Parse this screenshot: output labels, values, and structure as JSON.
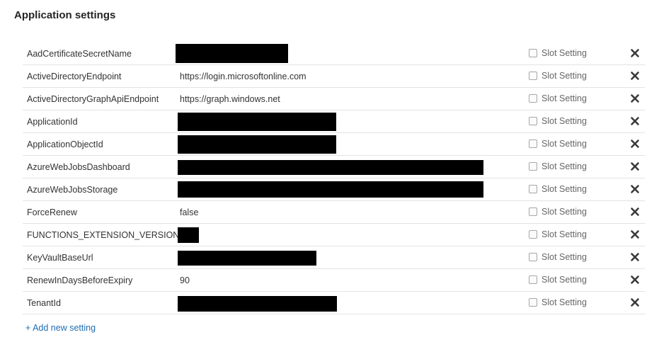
{
  "section": {
    "title": "Application settings"
  },
  "settings": [
    {
      "name": "AadCertificateSecretName",
      "value": "",
      "redacted": true,
      "slot_label": "Slot Setting",
      "slot_checked": false
    },
    {
      "name": "ActiveDirectoryEndpoint",
      "value": "https://login.microsoftonline.com",
      "redacted": false,
      "slot_label": "Slot Setting",
      "slot_checked": false
    },
    {
      "name": "ActiveDirectoryGraphApiEndpoint",
      "value": "https://graph.windows.net",
      "redacted": false,
      "slot_label": "Slot Setting",
      "slot_checked": false
    },
    {
      "name": "ApplicationId",
      "value": "",
      "redacted": true,
      "slot_label": "Slot Setting",
      "slot_checked": false
    },
    {
      "name": "ApplicationObjectId",
      "value": "",
      "redacted": true,
      "slot_label": "Slot Setting",
      "slot_checked": false
    },
    {
      "name": "AzureWebJobsDashboard",
      "value": "",
      "redacted": true,
      "slot_label": "Slot Setting",
      "slot_checked": false
    },
    {
      "name": "AzureWebJobsStorage",
      "value": "",
      "redacted": true,
      "slot_label": "Slot Setting",
      "slot_checked": false
    },
    {
      "name": "ForceRenew",
      "value": "false",
      "redacted": false,
      "slot_label": "Slot Setting",
      "slot_checked": false
    },
    {
      "name": "FUNCTIONS_EXTENSION_VERSION",
      "value": "",
      "redacted": true,
      "slot_label": "Slot Setting",
      "slot_checked": false
    },
    {
      "name": "KeyVaultBaseUrl",
      "value": "",
      "redacted": true,
      "slot_label": "Slot Setting",
      "slot_checked": false
    },
    {
      "name": "RenewInDaysBeforeExpiry",
      "value": "90",
      "redacted": false,
      "slot_label": "Slot Setting",
      "slot_checked": false
    },
    {
      "name": "TenantId",
      "value": "",
      "redacted": true,
      "slot_label": "Slot Setting",
      "slot_checked": false
    }
  ],
  "row_icons": {
    "slot_checkbox": "checkbox-icon",
    "delete": "close-icon"
  },
  "actions": {
    "add_label": "+ Add new setting"
  },
  "colors": {
    "link": "#1e6db3",
    "redaction": "#000000",
    "divider": "#e3e3e3"
  }
}
